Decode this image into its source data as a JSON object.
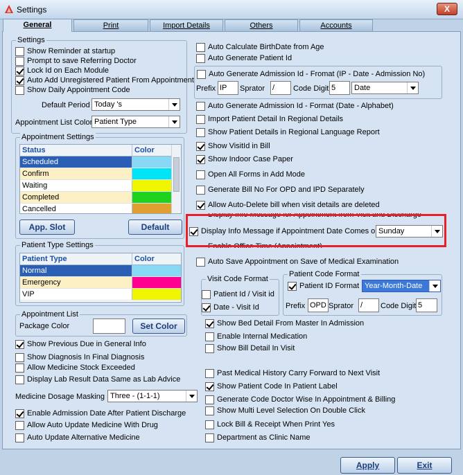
{
  "window": {
    "title": "Settings",
    "close_label": "X"
  },
  "tabs": [
    {
      "label": "General",
      "active": true
    },
    {
      "label": "Print"
    },
    {
      "label": "Import Details"
    },
    {
      "label": "Others"
    },
    {
      "label": "Accounts"
    }
  ],
  "settings_group": {
    "label": "Settings",
    "checks": [
      {
        "label": "Show Reminder at startup",
        "checked": false
      },
      {
        "label": "Prompt to save Referring Doctor",
        "checked": false
      },
      {
        "label": "Lock Id on Each Module",
        "checked": true
      },
      {
        "label": "Auto Add Unregistered Patient From Appointment",
        "checked": true
      },
      {
        "label": "Show Daily Appointment Code",
        "checked": false
      }
    ],
    "default_period_label": "Default Period",
    "default_period_value": "Today 's",
    "appt_color_label": "Appointment List Color",
    "appt_color_value": "Patient Type"
  },
  "appointment_settings": {
    "label": "Appointment Settings",
    "headers": [
      "Status",
      "Color"
    ],
    "rows": [
      {
        "status": "Scheduled",
        "row_bg": "#2a5fb5",
        "text": "#ffffff",
        "color": "#88d8f5"
      },
      {
        "status": "Confirm",
        "row_bg": "#fdf0c4",
        "text": "#000000",
        "color": "#00e5f5"
      },
      {
        "status": "Waiting",
        "row_bg": "#ffffff",
        "text": "#000000",
        "color": "#f0f500"
      },
      {
        "status": "Completed",
        "row_bg": "#fdf0c4",
        "text": "#000000",
        "color": "#1ed21e"
      },
      {
        "status": "Cancelled",
        "row_bg": "#ffffff",
        "text": "#000000",
        "color": "#e0a030"
      }
    ],
    "app_slot_button": "App. Slot",
    "default_button": "Default"
  },
  "patient_type_settings": {
    "label": "Patient Type Settings",
    "headers": [
      "Patient Type",
      "Color"
    ],
    "rows": [
      {
        "type": "Normal",
        "row_bg": "#2a5fb5",
        "text": "#ffffff",
        "color": "#88d8f5"
      },
      {
        "type": "Emergency",
        "row_bg": "#fdf0c4",
        "text": "#000000",
        "color": "#ff0090"
      },
      {
        "type": "VIP",
        "row_bg": "#ffffff",
        "text": "#000000",
        "color": "#f0f500"
      }
    ]
  },
  "appointment_list": {
    "label": "Appointment List",
    "package_color_label": "Package Color",
    "set_color_button": "Set Color"
  },
  "left_checks": [
    {
      "label": "Show Previous Due in General Info",
      "checked": true
    },
    {
      "label": "Show Diagnosis In Final Diagnosis",
      "checked": false
    },
    {
      "label": "Allow Medicine Stock Exceeded",
      "checked": false
    },
    {
      "label": "Display Lab Result Data Same as Lab Advice",
      "checked": false
    }
  ],
  "medicine_masking": {
    "label": "Medicine Dosage Masking",
    "value": "Three - (1-1-1)"
  },
  "left_checks_bottom": [
    {
      "label": "Enable Admission Date After Patient Discharge",
      "checked": true
    },
    {
      "label": "Allow Auto Update Medicine With Drug",
      "checked": false
    },
    {
      "label": "Auto Update Alternative Medicine",
      "checked": false
    }
  ],
  "right_top_checks": [
    {
      "label": "Auto Calculate BirthDate from Age",
      "checked": false
    },
    {
      "label": "Auto Generate Patient Id",
      "checked": false
    }
  ],
  "admission_group": {
    "check_label": "Auto Generate Admission Id  - Fromat (IP - Date - Admission No)",
    "checked": false,
    "prefix_label": "Prefix",
    "prefix_value": "IP",
    "separator_label": "Sprator",
    "separator_value": "/",
    "code_digit_label": "Code Digit",
    "code_digit_value": "5",
    "date_value": "Date"
  },
  "right_checks": [
    {
      "label": "Auto Generate Admission Id - Format (Date - Alphabet)",
      "checked": false
    },
    {
      "label": "Import Patient Detail In Regional Details",
      "checked": false
    },
    {
      "label": "Show Patient Details in Regional Language Report",
      "checked": false
    },
    {
      "label": "Show VisitId in Bill",
      "checked": true
    },
    {
      "label": "Show Indoor Case Paper",
      "checked": true
    },
    {
      "label": "Open All Forms in Add Mode",
      "checked": false
    },
    {
      "label": "Generate Bill No For OPD and IPD Separately",
      "checked": false
    },
    {
      "label": "Allow Auto-Delete bill when visit details are deleted",
      "checked": true
    }
  ],
  "info_message_check": {
    "label": "Display Info Message for Appointment from Visit and Discharge",
    "checked": false
  },
  "appointment_date_info": {
    "label": "Display Info Message if Appointment Date Comes on",
    "checked": true,
    "day_value": "Sunday"
  },
  "office_time_check": {
    "label": "Enable Office Time (Appointment)",
    "checked": false
  },
  "auto_save_check": {
    "label": "Auto Save Appointment on Save of Medical Examination",
    "checked": false
  },
  "visit_code_format": {
    "label": "Visit Code Format",
    "options": [
      {
        "label": "Patient Id / Visit id",
        "checked": false
      },
      {
        "label": "Date - Visit Id",
        "checked": true
      }
    ]
  },
  "patient_code_format": {
    "label": "Patient Code Format",
    "patient_id_format_label": "Patient ID Format",
    "checked": true,
    "format_value": "Year-Month-Date",
    "prefix_label": "Prefix",
    "prefix_value": "OPD",
    "separator_label": "Sprator",
    "separator_value": "/",
    "code_digit_label": "Code Digit",
    "code_digit_value": "5"
  },
  "mid_checks": [
    {
      "label": "Show Bed Detail From Master In Admission",
      "checked": true
    },
    {
      "label": "Enable Internal Medication",
      "checked": false
    },
    {
      "label": "Show Bill Detail In Visit",
      "checked": false
    }
  ],
  "bottom_checks": [
    {
      "label": "Past Medical History Carry Forward to Next Visit",
      "checked": false
    },
    {
      "label": "Show Patient Code In Patient Label",
      "checked": true
    },
    {
      "label": "Generate Code Doctor Wise In Appointment & Billing",
      "checked": false
    },
    {
      "label": "Show Multi Level Selection On Double Click",
      "checked": false
    },
    {
      "label": "Lock Bill & Receipt When Print Yes",
      "checked": false
    },
    {
      "label": "Department as Clinic Name",
      "checked": false
    }
  ],
  "footer": {
    "apply_label": "Apply",
    "exit_label": "Exit"
  }
}
